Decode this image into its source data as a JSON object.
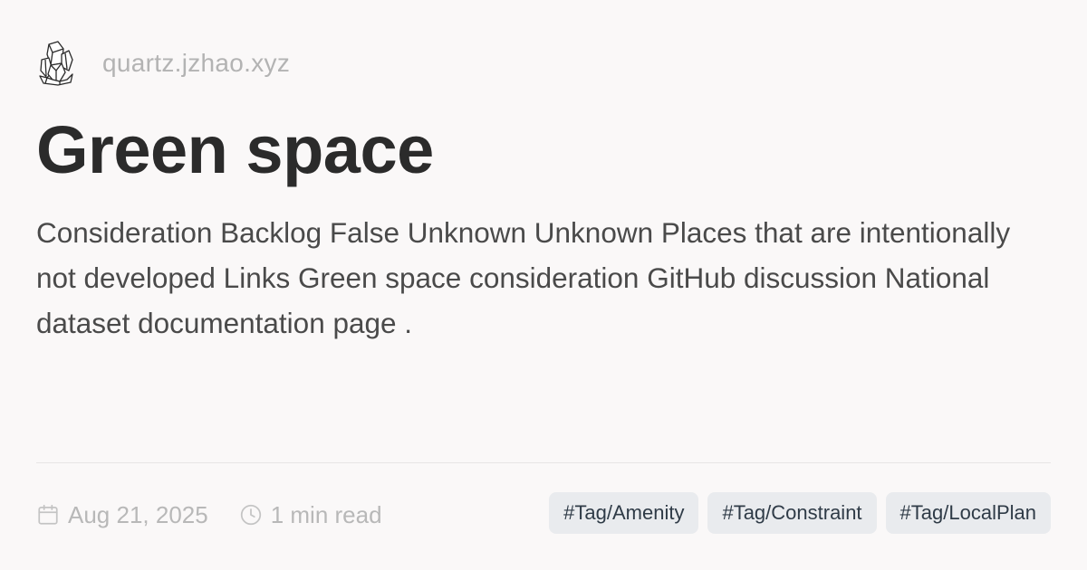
{
  "site": {
    "logo_icon": "crystal-logo-icon",
    "url": "quartz.jzhao.xyz"
  },
  "page": {
    "title": "Green space",
    "description": "Consideration Backlog False Unknown Unknown Places that are intentionally not developed Links Green space consideration GitHub discussion National dataset documentation page ."
  },
  "meta": {
    "date_icon": "calendar-icon",
    "date": "Aug 21, 2025",
    "reading_icon": "clock-icon",
    "reading_time": "1 min read"
  },
  "tags": [
    {
      "label": "#Tag/Amenity"
    },
    {
      "label": "#Tag/Constraint"
    },
    {
      "label": "#Tag/LocalPlan"
    }
  ],
  "colors": {
    "background": "#faf8f8",
    "title": "#2b2b2b",
    "text": "#4a4a4a",
    "muted": "#b8b8b8",
    "tag_background": "#e9ebee",
    "tag_text": "#2f3b47"
  }
}
